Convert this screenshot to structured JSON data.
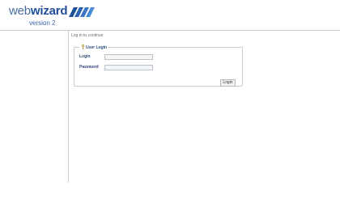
{
  "header": {
    "logo_word_web": "web",
    "logo_word_wizard": "wizard",
    "logo_version": "version 2"
  },
  "main": {
    "intro_text": "Log in to continue",
    "login_box": {
      "title": "User Login",
      "login_label": "Login",
      "login_value": "",
      "password_label": "Password",
      "password_value": "",
      "submit_label": "Login"
    }
  },
  "colors": {
    "brand_blue": "#1f4f9a",
    "brand_light_blue": "#4d6fa8",
    "label_blue": "#2c4a7a"
  },
  "icons": {
    "legend_icon": "key-icon"
  }
}
